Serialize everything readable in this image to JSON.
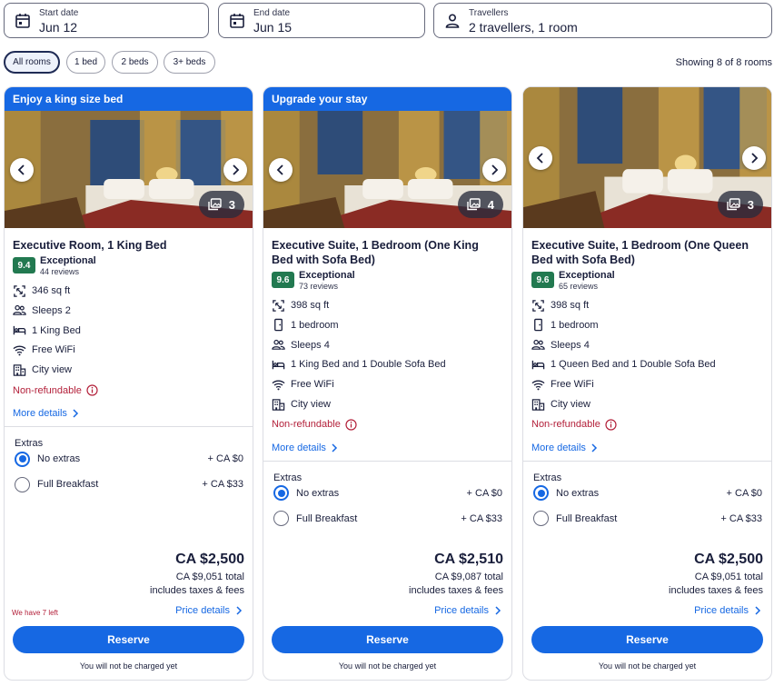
{
  "search": {
    "start": {
      "label": "Start date",
      "value": "Jun 12"
    },
    "end": {
      "label": "End date",
      "value": "Jun 15"
    },
    "travellers": {
      "label": "Travellers",
      "value": "2 travellers, 1 room"
    }
  },
  "filters": [
    "All rooms",
    "1 bed",
    "2 beds",
    "3+ beds"
  ],
  "showing": "Showing 8 of 8 rooms",
  "colors": {
    "accent": "#1668e3",
    "score": "#227950",
    "alert": "#b3203a"
  },
  "cards": [
    {
      "banner": "Enjoy a king size bed",
      "photos": "3",
      "title": "Executive Room, 1 King Bed",
      "score": "9.4",
      "rating_label": "Exceptional",
      "reviews": "44 reviews",
      "amenities": [
        {
          "icon": "area-icon",
          "text": "346 sq ft"
        },
        {
          "icon": "people-icon",
          "text": "Sleeps 2"
        },
        {
          "icon": "bed-icon",
          "text": "1 King Bed"
        },
        {
          "icon": "wifi-icon",
          "text": "Free WiFi"
        },
        {
          "icon": "city-icon",
          "text": "City view"
        }
      ],
      "nonrefundable": "Non-refundable",
      "more": "More details",
      "extras_title": "Extras",
      "options": [
        {
          "label": "No extras",
          "price": "+ CA $0"
        },
        {
          "label": "Full Breakfast",
          "price": "+ CA $33"
        }
      ],
      "price": "CA $2,500",
      "total": "CA $9,051 total",
      "taxes": "includes taxes & fees",
      "left": "We have 7 left",
      "price_details": "Price details",
      "reserve": "Reserve",
      "no_charge": "You will not be charged yet"
    },
    {
      "banner": "Upgrade your stay",
      "photos": "4",
      "title": "Executive Suite, 1 Bedroom (One King Bed with Sofa Bed)",
      "score": "9.6",
      "rating_label": "Exceptional",
      "reviews": "73 reviews",
      "amenities": [
        {
          "icon": "area-icon",
          "text": "398 sq ft"
        },
        {
          "icon": "door-icon",
          "text": "1 bedroom"
        },
        {
          "icon": "people-icon",
          "text": "Sleeps 4"
        },
        {
          "icon": "bed-icon",
          "text": "1 King Bed and 1 Double Sofa Bed"
        },
        {
          "icon": "wifi-icon",
          "text": "Free WiFi"
        },
        {
          "icon": "city-icon",
          "text": "City view"
        }
      ],
      "nonrefundable": "Non-refundable",
      "more": "More details",
      "extras_title": "Extras",
      "options": [
        {
          "label": "No extras",
          "price": "+ CA $0"
        },
        {
          "label": "Full Breakfast",
          "price": "+ CA $33"
        }
      ],
      "price": "CA $2,510",
      "total": "CA $9,087 total",
      "taxes": "includes taxes & fees",
      "left": "",
      "price_details": "Price details",
      "reserve": "Reserve",
      "no_charge": "You will not be charged yet"
    },
    {
      "banner": "",
      "photos": "3",
      "title": "Executive Suite, 1 Bedroom (One Queen Bed with Sofa Bed)",
      "score": "9.6",
      "rating_label": "Exceptional",
      "reviews": "65 reviews",
      "amenities": [
        {
          "icon": "area-icon",
          "text": "398 sq ft"
        },
        {
          "icon": "door-icon",
          "text": "1 bedroom"
        },
        {
          "icon": "people-icon",
          "text": "Sleeps 4"
        },
        {
          "icon": "bed-icon",
          "text": "1 Queen Bed and 1 Double Sofa Bed"
        },
        {
          "icon": "wifi-icon",
          "text": "Free WiFi"
        },
        {
          "icon": "city-icon",
          "text": "City view"
        }
      ],
      "nonrefundable": "Non-refundable",
      "more": "More details",
      "extras_title": "Extras",
      "options": [
        {
          "label": "No extras",
          "price": "+ CA $0"
        },
        {
          "label": "Full Breakfast",
          "price": "+ CA $33"
        }
      ],
      "price": "CA $2,500",
      "total": "CA $9,051 total",
      "taxes": "includes taxes & fees",
      "left": "",
      "price_details": "Price details",
      "reserve": "Reserve",
      "no_charge": "You will not be charged yet"
    }
  ]
}
